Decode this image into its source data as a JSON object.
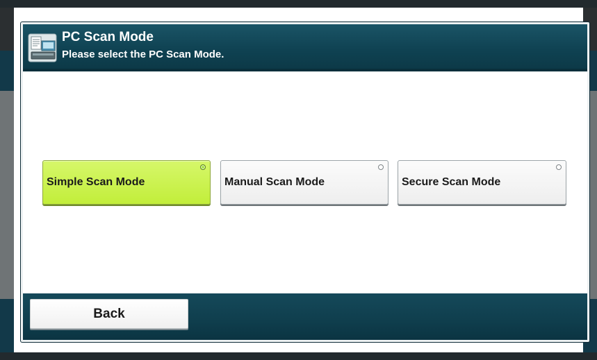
{
  "header": {
    "title": "PC Scan Mode",
    "subtitle": "Please select the PC Scan Mode.",
    "icon": "scanner-icon"
  },
  "modes": [
    {
      "label": "Simple Scan Mode",
      "selected": true
    },
    {
      "label": "Manual Scan Mode",
      "selected": false
    },
    {
      "label": "Secure Scan Mode",
      "selected": false
    }
  ],
  "footer": {
    "back_label": "Back"
  },
  "colors": {
    "header_bg": "#0f4252",
    "selected_bg": "#c8f24a",
    "button_bg": "#f2f2f2"
  }
}
